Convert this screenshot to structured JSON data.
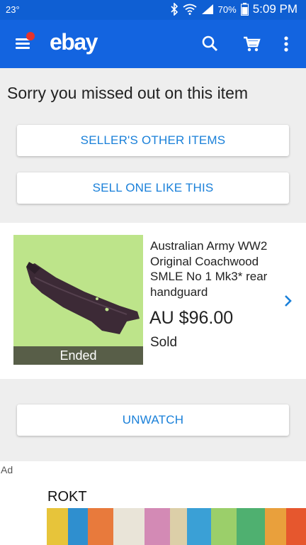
{
  "status_bar": {
    "temperature": "23°",
    "battery": "70%",
    "time": "5:09 PM"
  },
  "app_bar": {
    "logo": "ebay",
    "menu_icon": "hamburger-menu-icon",
    "search_icon": "search-icon",
    "cart_icon": "cart-icon",
    "more_icon": "more-vert-icon"
  },
  "main": {
    "title": "Sorry you missed out on this item",
    "seller_button": "SELLER'S OTHER ITEMS",
    "sell_button": "SELL ONE LIKE THIS",
    "unwatch_button": "UNWATCH"
  },
  "item": {
    "title": "Australian Army WW2 Original Coachwood SMLE No 1  Mk3* rear handguard",
    "price": "AU $96.00",
    "status": "Sold",
    "thumb_badge": "Ended"
  },
  "ad": {
    "label": "Ad",
    "brand": "ROKT"
  },
  "colors": {
    "brand_blue": "#1364e0",
    "link_blue": "#1a80d9",
    "notification_red": "#e4332c"
  }
}
